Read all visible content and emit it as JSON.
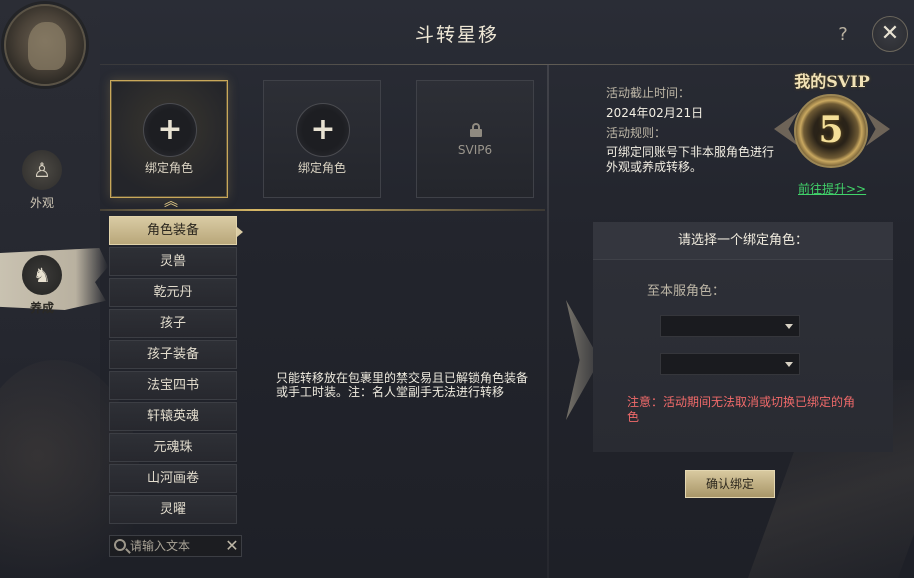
{
  "window": {
    "title": "斗转星移",
    "help_label": "?",
    "close_label": "✕"
  },
  "rail": {
    "tabs": [
      {
        "label": "外观",
        "icon": "robe-icon",
        "active": false
      },
      {
        "label": "养成",
        "icon": "character-icon",
        "active": true
      }
    ]
  },
  "slots": [
    {
      "label": "绑定角色",
      "state": "selected",
      "icon": "plus-icon"
    },
    {
      "label": "绑定角色",
      "state": "empty",
      "icon": "plus-icon"
    },
    {
      "label": "SVIP6",
      "state": "locked",
      "icon": "lock-icon"
    }
  ],
  "categories": [
    "角色装备",
    "灵兽",
    "乾元丹",
    "孩子",
    "孩子装备",
    "法宝四书",
    "轩辕英魂",
    "元魂珠",
    "山河画卷",
    "灵曜"
  ],
  "selected_category": "角色装备",
  "search": {
    "placeholder": "请输入文本",
    "value": ""
  },
  "description": "只能转移放在包裹里的禁交易且已解锁角色装备或手工时装。注：名人堂副手无法进行转移",
  "info": {
    "deadline_label": "活动截止时间：",
    "deadline_value": "2024年02月21日",
    "rules_label": "活动规则：",
    "rules_text": "可绑定同账号下非本服角色进行外观或养成转移。"
  },
  "svip": {
    "title": "我的SVIP",
    "level": "5",
    "upgrade_link": "前往提升>>"
  },
  "bind": {
    "header": "请选择一个绑定角色：",
    "server_label": "至本服角色：",
    "select_1_value": "",
    "select_2_value": "",
    "notice": "注意：活动期间无法取消或切换已绑定的角色",
    "confirm_label": "确认绑定"
  },
  "colors": {
    "accent_gold": "#c9a85a",
    "notice_red": "#f06a6a",
    "link_green": "#41d36a",
    "selected_tab_bg": "#d9cba4"
  }
}
